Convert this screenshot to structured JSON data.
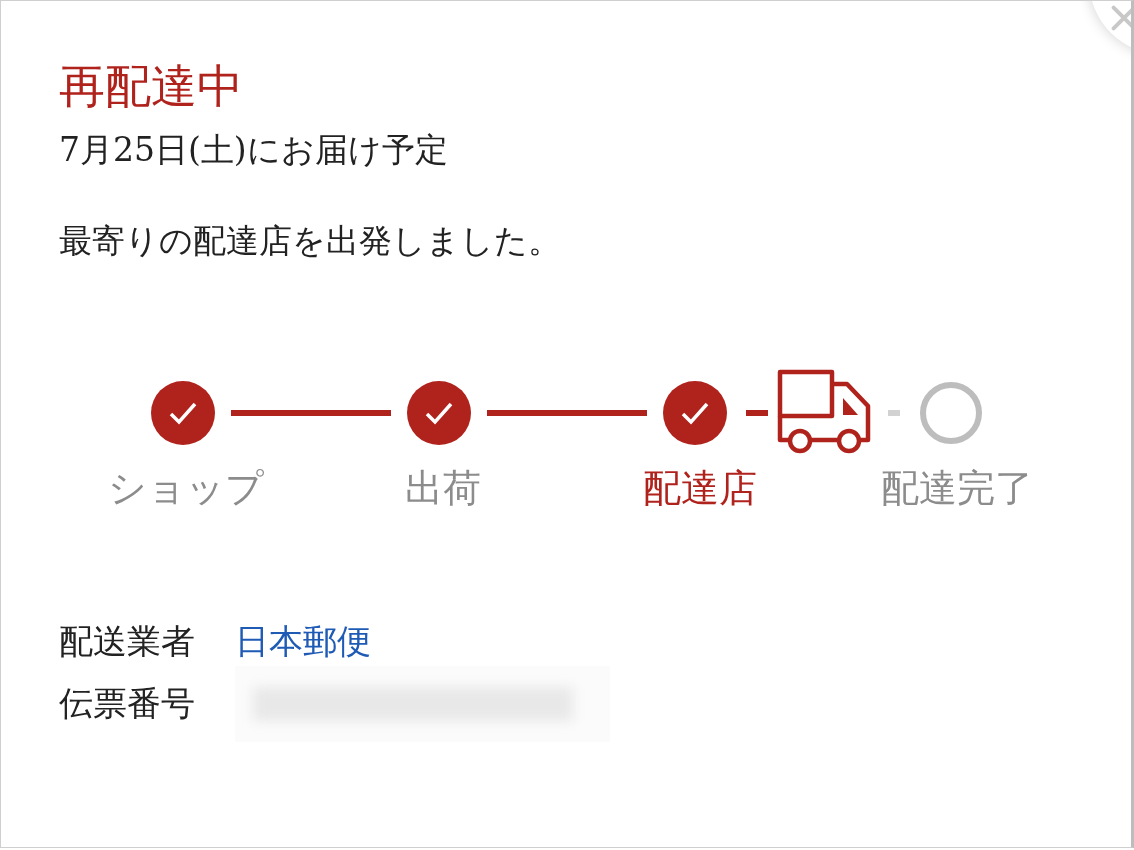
{
  "status": {
    "title": "再配達中",
    "delivery_date": "7月25日(土)にお届け予定",
    "message": "最寄りの配達店を出発しました。"
  },
  "steps": [
    {
      "label": "ショップ",
      "kind": "done",
      "current": false,
      "in_transit": false
    },
    {
      "label": "出荷",
      "kind": "done",
      "current": false,
      "in_transit": false
    },
    {
      "label": "配達店",
      "kind": "done",
      "current": true,
      "in_transit": true
    },
    {
      "label": "配達完了",
      "kind": "pending",
      "current": false
    }
  ],
  "carrier": {
    "label": "配送業者",
    "value": "日本郵便"
  },
  "tracking": {
    "label": "伝票番号",
    "redacted": true
  }
}
